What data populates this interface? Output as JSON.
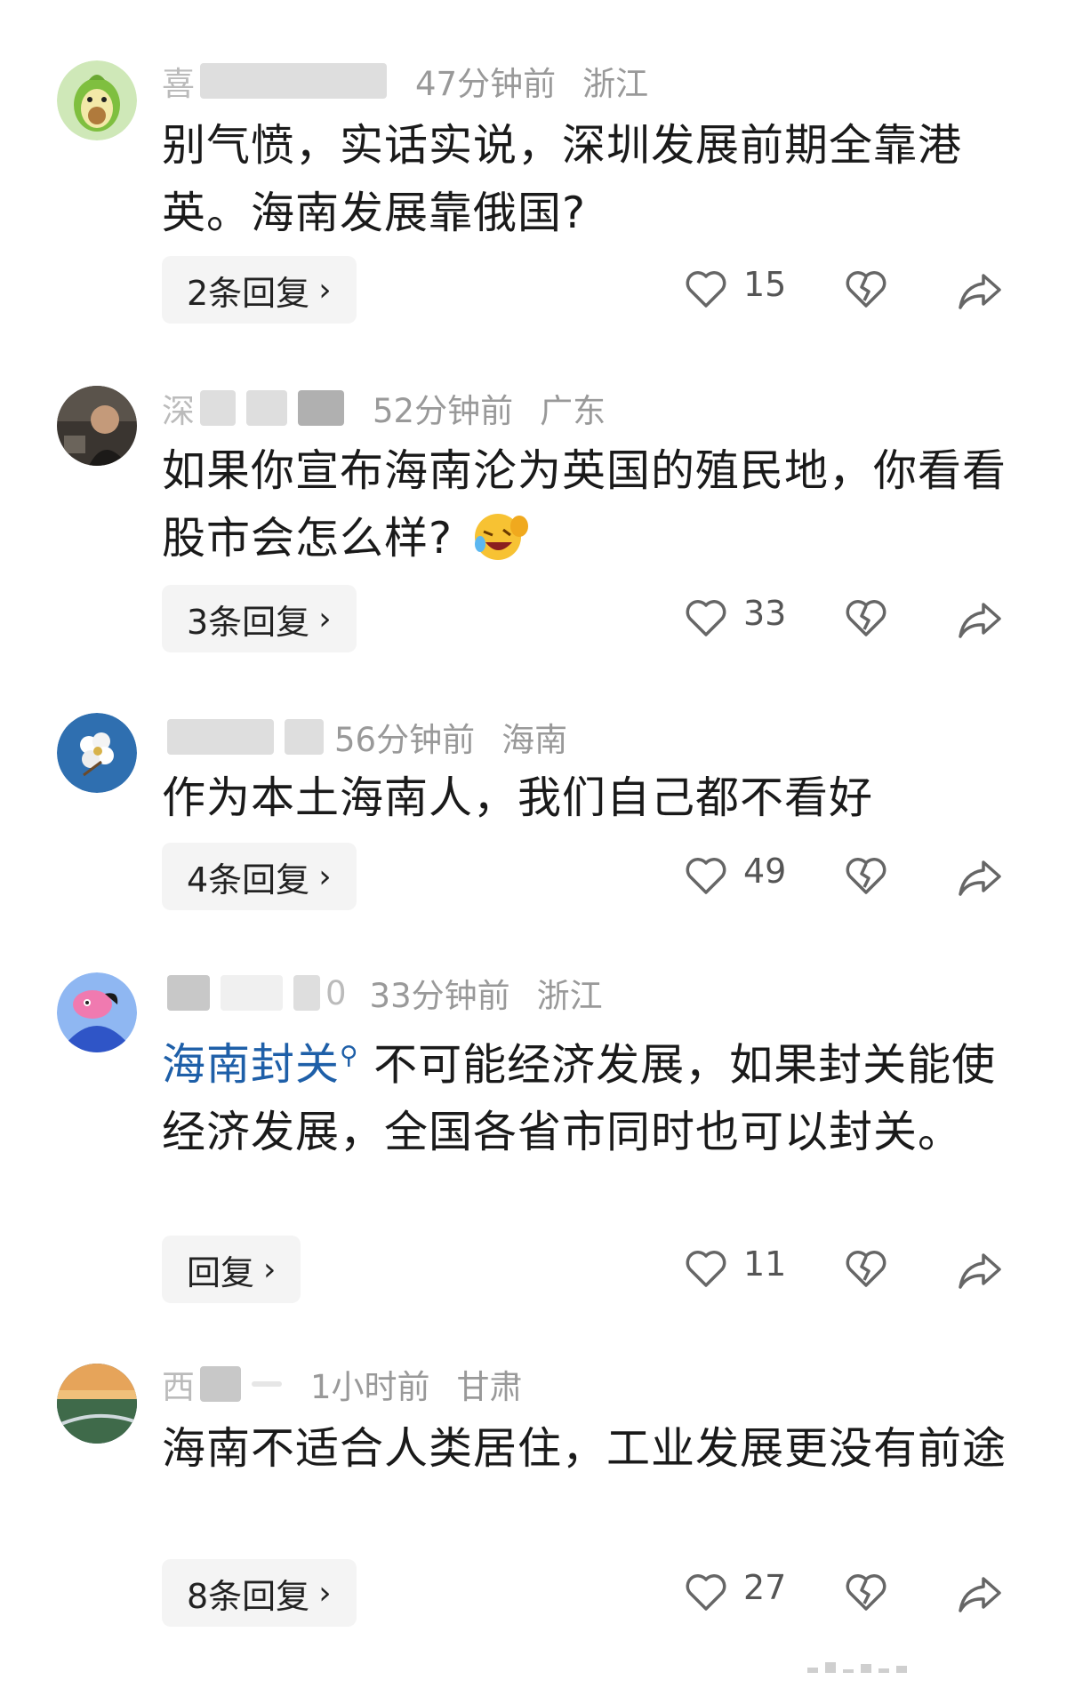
{
  "comments": [
    {
      "name": "喜",
      "time": "47分钟前",
      "location": "浙江",
      "text": "别气愤，实话实说，深圳发展前期全靠港英。海南发展靠俄国?",
      "replies": "2条回复",
      "likes": "15",
      "avatar": "avocado-avatar"
    },
    {
      "name": "深",
      "time": "52分钟前",
      "location": "广东",
      "text": "如果你宣布海南沦为英国的殖民地，你看看股市会怎么样?",
      "replies": "3条回复",
      "likes": "33",
      "avatar": "man-photo-avatar",
      "emoji": "laughing-emoji"
    },
    {
      "name": "",
      "time": "56分钟前",
      "location": "海南",
      "text": "作为本土海南人，我们自己都不看好",
      "replies": "4条回复",
      "likes": "49",
      "avatar": "flower-avatar"
    },
    {
      "name": "0",
      "time": "33分钟前",
      "location": "浙江",
      "link_text": "海南封关",
      "text": "不可能经济发展，如果封关能使经济发展，全国各省市同时也可以封关。",
      "replies": "回复",
      "likes": "11",
      "avatar": "cartoon-avatar"
    },
    {
      "name": "西",
      "time": "1小时前",
      "location": "甘肃",
      "text": "海南不适合人类居住，工业发展更没有前途",
      "replies": "8条回复",
      "likes": "27",
      "avatar": "landscape-avatar"
    }
  ],
  "colors": {
    "link": "#1e5fa8",
    "meta": "#999999",
    "text": "#1a1a1a",
    "reply_bg": "#f4f4f4"
  }
}
